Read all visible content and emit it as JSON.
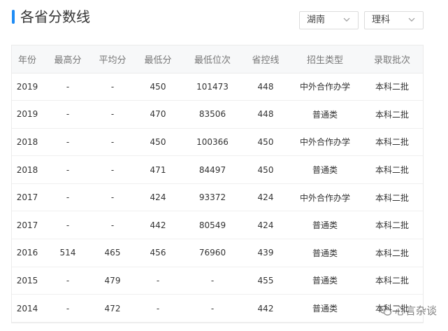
{
  "header": {
    "title": "各省分数线",
    "accent_color": "#1f8cf5",
    "province_select": {
      "value": "湖南",
      "icon": "chevron-down-icon"
    },
    "subject_select": {
      "value": "理科",
      "icon": "chevron-down-icon"
    }
  },
  "table": {
    "columns": [
      "年份",
      "最高分",
      "平均分",
      "最低分",
      "最低位次",
      "省控线",
      "招生类型",
      "录取批次"
    ],
    "rows": [
      [
        "2019",
        "-",
        "-",
        "450",
        "101473",
        "448",
        "中外合作办学",
        "本科二批"
      ],
      [
        "2019",
        "-",
        "-",
        "470",
        "83506",
        "448",
        "普通类",
        "本科二批"
      ],
      [
        "2018",
        "-",
        "-",
        "450",
        "100366",
        "450",
        "中外合作办学",
        "本科二批"
      ],
      [
        "2018",
        "-",
        "-",
        "471",
        "84497",
        "450",
        "普通类",
        "本科二批"
      ],
      [
        "2017",
        "-",
        "-",
        "424",
        "93372",
        "424",
        "中外合作办学",
        "本科二批"
      ],
      [
        "2017",
        "-",
        "-",
        "442",
        "80549",
        "424",
        "普通类",
        "本科二批"
      ],
      [
        "2016",
        "514",
        "465",
        "456",
        "76960",
        "439",
        "普通类",
        "本科二批"
      ],
      [
        "2015",
        "-",
        "479",
        "-",
        "-",
        "455",
        "普通类",
        "本科二批"
      ],
      [
        "2014",
        "-",
        "472",
        "-",
        "-",
        "442",
        "普通类",
        "本科二批"
      ]
    ]
  },
  "watermark": {
    "text": "心言杂谈",
    "icon": "wechat-icon"
  }
}
